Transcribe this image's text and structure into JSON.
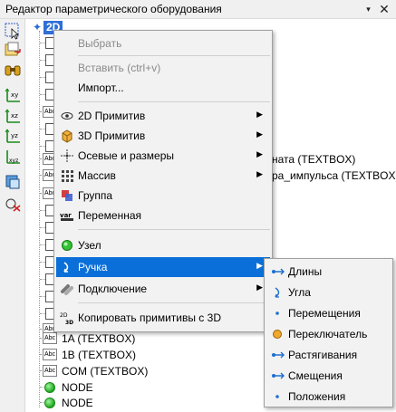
{
  "window": {
    "title": "Редактор параметрического оборудования",
    "dropdown_glyph": "▾",
    "close_glyph": "✕"
  },
  "toolbar": {
    "icons": [
      "select-icon",
      "import-icon",
      "binoculars-icon",
      "axis-xy-icon",
      "axis-xz-icon",
      "axis-yz-icon",
      "axis-xyz-icon",
      "view3d-icon",
      "clear-icon"
    ]
  },
  "tree": {
    "root_label": "2D",
    "visible_tails": {
      "row8": "ната (TEXTBOX)",
      "row9": "ра_импульса (TEXTBOX)"
    },
    "bottom_items": [
      {
        "label": "1A (TEXTBOX)",
        "icon": "textbox-icon"
      },
      {
        "label": "1B (TEXTBOX)",
        "icon": "textbox-icon"
      },
      {
        "label": "COM (TEXTBOX)",
        "icon": "textbox-icon"
      },
      {
        "label": "NODE",
        "icon": "node-icon"
      },
      {
        "label": "NODE",
        "icon": "node-icon"
      }
    ]
  },
  "context_menu": {
    "select": "Выбрать",
    "paste": "Вставить (ctrl+v)",
    "import": "Импорт...",
    "primitive_2d": "2D Примитив",
    "primitive_3d": "3D Примитив",
    "axes_dims": "Осевые и размеры",
    "array": "Массив",
    "group": "Группа",
    "variable": "Переменная",
    "node": "Узел",
    "handle": "Ручка",
    "connection": "Подключение",
    "copy_3d": "Копировать примитивы с 3D"
  },
  "submenu": {
    "lengths": "Длины",
    "angle": "Угла",
    "movement": "Перемещения",
    "switch": "Переключатель",
    "stretch": "Растягивания",
    "offset": "Смещения",
    "position": "Положения"
  },
  "colors": {
    "selection": "#0a6fd8",
    "accent": "#2f6fd6",
    "node_green": "#1fa81f"
  }
}
